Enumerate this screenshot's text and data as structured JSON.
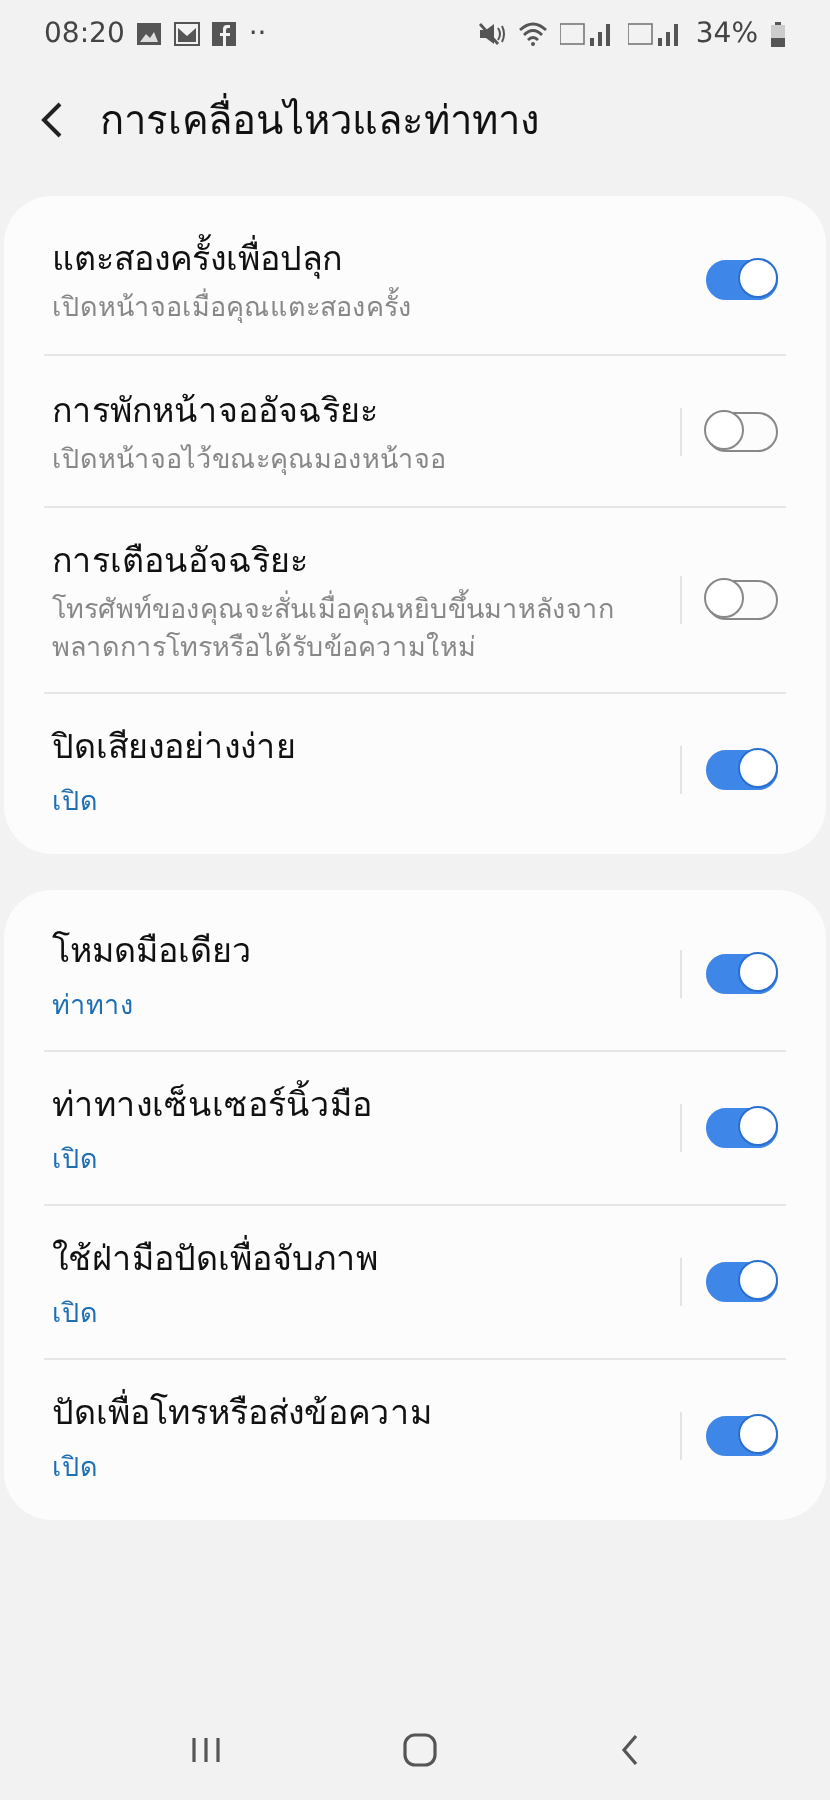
{
  "status_bar": {
    "time": "08:20",
    "dots": "··",
    "battery": "34%"
  },
  "header": {
    "title": "การเคลื่อนไหวและท่าทาง"
  },
  "groups": [
    {
      "items": [
        {
          "title": "แตะสองครั้งเพื่อปลุก",
          "subtitle": {
            "kind": "description",
            "text": "เปิดหน้าจอเมื่อคุณแตะสองครั้ง"
          },
          "on": true,
          "divider": false
        },
        {
          "title": "การพักหน้าจออัจฉริยะ",
          "subtitle": {
            "kind": "description",
            "text": "เปิดหน้าจอไว้ขณะคุณมองหน้าจอ"
          },
          "on": false,
          "divider": true
        },
        {
          "title": "การเตือนอัจฉริยะ",
          "subtitle": {
            "kind": "description",
            "text": "โทรศัพท์ของคุณจะสั่นเมื่อคุณหยิบขึ้นมาหลังจากพลาดการโทรหรือได้รับข้อความใหม่"
          },
          "on": false,
          "divider": true
        },
        {
          "title": "ปิดเสียงอย่างง่าย",
          "subtitle": {
            "kind": "status",
            "text": "เปิด"
          },
          "on": true,
          "divider": true
        }
      ]
    },
    {
      "items": [
        {
          "title": "โหมดมือเดียว",
          "subtitle": {
            "kind": "status",
            "text": "ท่าทาง"
          },
          "on": true,
          "divider": true
        },
        {
          "title": "ท่าทางเซ็นเซอร์นิ้วมือ",
          "subtitle": {
            "kind": "status",
            "text": "เปิด"
          },
          "on": true,
          "divider": true
        },
        {
          "title": "ใช้ฝ่ามือปัดเพื่อจับภาพ",
          "subtitle": {
            "kind": "status",
            "text": "เปิด"
          },
          "on": true,
          "divider": true
        },
        {
          "title": "ปัดเพื่อโทรหรือส่งข้อความ",
          "subtitle": {
            "kind": "status",
            "text": "เปิด"
          },
          "on": true,
          "divider": true
        }
      ]
    }
  ]
}
